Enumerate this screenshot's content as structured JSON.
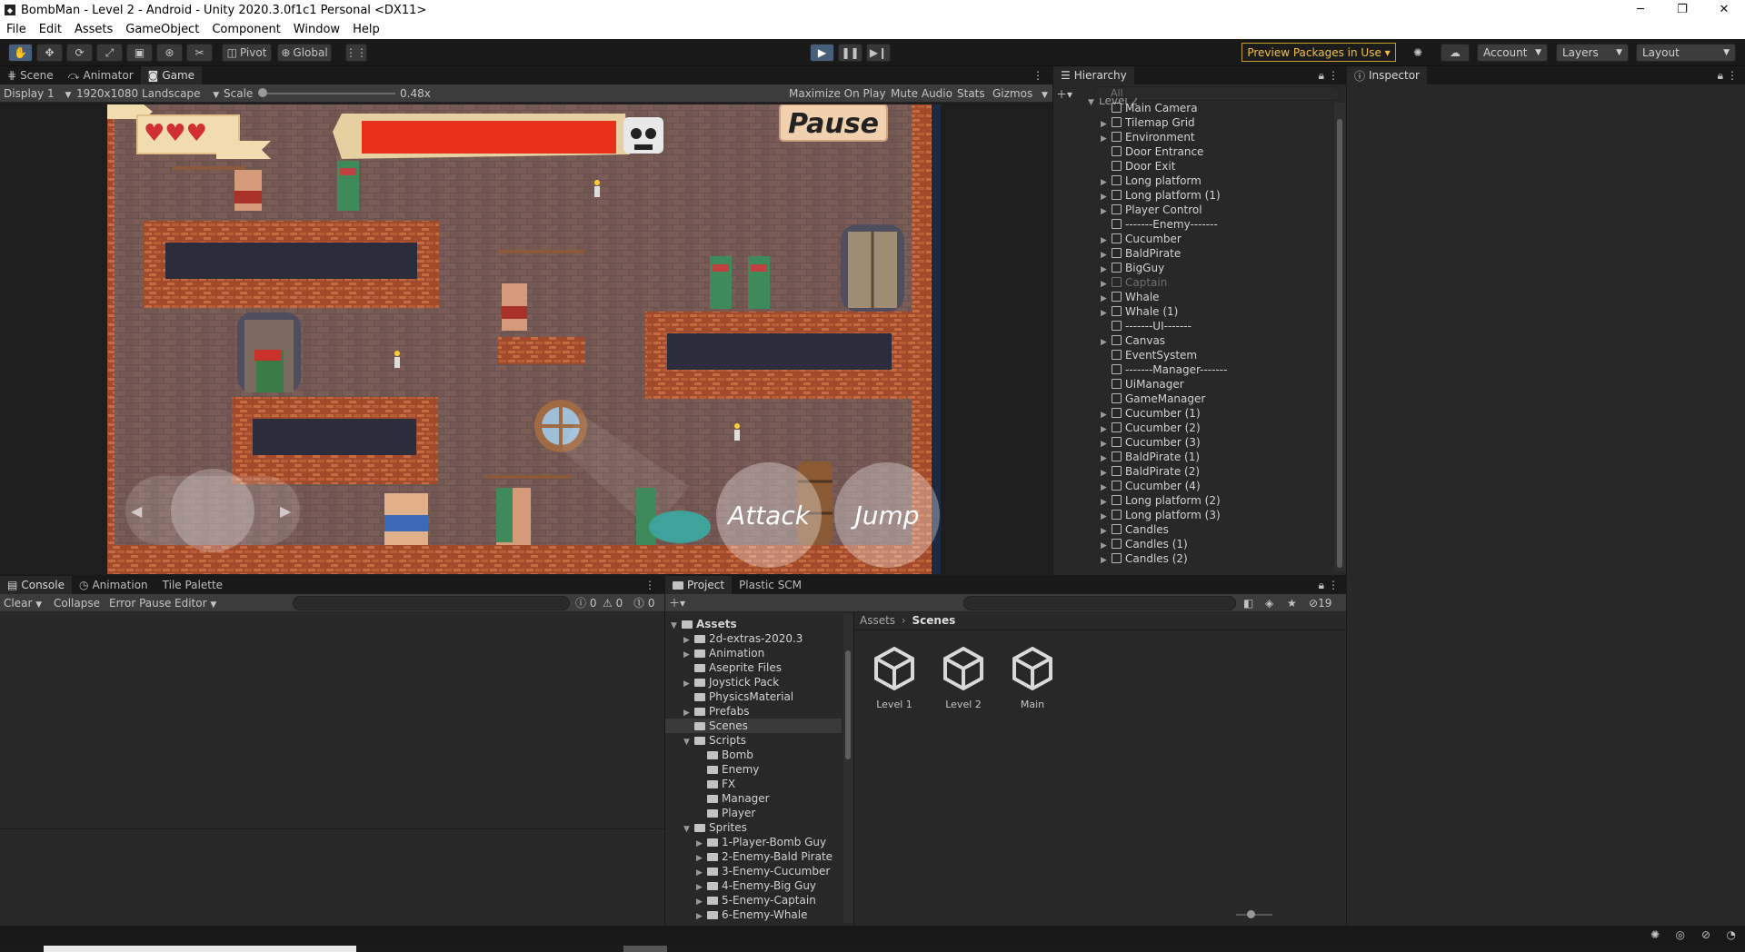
{
  "window": {
    "title": "BombMan - Level 2 - Android - Unity 2020.3.0f1c1 Personal <DX11>",
    "minimize": "─",
    "restore": "❐",
    "close": "✕"
  },
  "menu": [
    "File",
    "Edit",
    "Assets",
    "GameObject",
    "Component",
    "Window",
    "Help"
  ],
  "toolbar": {
    "pivot_label": "Pivot",
    "global_label": "Global",
    "preview_packages": "Preview Packages in Use ▾",
    "account": "Account",
    "layers": "Layers",
    "layout": "Layout"
  },
  "scene_tabs": [
    "Scene",
    "Animator",
    "Game"
  ],
  "game_bar": {
    "display": "Display 1",
    "resolution": "1920x1080 Landscape",
    "scale_label": "Scale",
    "scale_value": "0.48x",
    "maximize": "Maximize On Play",
    "mute": "Mute Audio",
    "stats": "Stats",
    "gizmos": "Gizmos"
  },
  "game_ui": {
    "pause": "Pause",
    "attack": "Attack",
    "jump": "Jump"
  },
  "hierarchy": {
    "tab": "Hierarchy",
    "search_placeholder": "All",
    "root": "Level 2",
    "items": [
      {
        "label": "Main Camera",
        "expandable": false,
        "dim": false
      },
      {
        "label": "Tilemap Grid",
        "expandable": true,
        "dim": false
      },
      {
        "label": "Environment",
        "expandable": true,
        "dim": false
      },
      {
        "label": "Door Entrance",
        "expandable": false,
        "dim": false
      },
      {
        "label": "Door Exit",
        "expandable": false,
        "dim": false
      },
      {
        "label": "Long platform",
        "expandable": true,
        "dim": false
      },
      {
        "label": "Long platform (1)",
        "expandable": true,
        "dim": false
      },
      {
        "label": "Player Control",
        "expandable": true,
        "dim": false
      },
      {
        "label": "-------Enemy-------",
        "expandable": false,
        "dim": false
      },
      {
        "label": "Cucumber",
        "expandable": true,
        "dim": false
      },
      {
        "label": "BaldPirate",
        "expandable": true,
        "dim": false
      },
      {
        "label": "BigGuy",
        "expandable": true,
        "dim": false
      },
      {
        "label": "Captain",
        "expandable": true,
        "dim": true
      },
      {
        "label": "Whale",
        "expandable": true,
        "dim": false
      },
      {
        "label": "Whale (1)",
        "expandable": true,
        "dim": false
      },
      {
        "label": "-------UI-------",
        "expandable": false,
        "dim": false
      },
      {
        "label": "Canvas",
        "expandable": true,
        "dim": false
      },
      {
        "label": "EventSystem",
        "expandable": false,
        "dim": false
      },
      {
        "label": "-------Manager-------",
        "expandable": false,
        "dim": false
      },
      {
        "label": "UiManager",
        "expandable": false,
        "dim": false
      },
      {
        "label": "GameManager",
        "expandable": false,
        "dim": false
      },
      {
        "label": "Cucumber (1)",
        "expandable": true,
        "dim": false
      },
      {
        "label": "Cucumber (2)",
        "expandable": true,
        "dim": false
      },
      {
        "label": "Cucumber (3)",
        "expandable": true,
        "dim": false
      },
      {
        "label": "BaldPirate (1)",
        "expandable": true,
        "dim": false
      },
      {
        "label": "BaldPirate (2)",
        "expandable": true,
        "dim": false
      },
      {
        "label": "Cucumber (4)",
        "expandable": true,
        "dim": false
      },
      {
        "label": "Long platform (2)",
        "expandable": true,
        "dim": false
      },
      {
        "label": "Long platform (3)",
        "expandable": true,
        "dim": false
      },
      {
        "label": "Candles",
        "expandable": true,
        "dim": false
      },
      {
        "label": "Candles (1)",
        "expandable": true,
        "dim": false
      },
      {
        "label": "Candles (2)",
        "expandable": true,
        "dim": false
      }
    ]
  },
  "inspector": {
    "tab": "Inspector"
  },
  "console": {
    "tabs": [
      "Console",
      "Animation",
      "Tile Palette"
    ],
    "clear": "Clear",
    "collapse": "Collapse",
    "error_pause": "Error Pause",
    "editor": "Editor",
    "count_info": "0",
    "count_warn": "0",
    "count_error": "0"
  },
  "project": {
    "tabs": [
      "Project",
      "Plastic SCM"
    ],
    "hidden_count": "19",
    "breadcrumb_root": "Assets",
    "breadcrumb_current": "Scenes",
    "tree": [
      {
        "label": "Assets",
        "depth": 0,
        "expanded": true,
        "selected": false
      },
      {
        "label": "2d-extras-2020.3",
        "depth": 1,
        "expanded": false,
        "selected": false
      },
      {
        "label": "Animation",
        "depth": 1,
        "expanded": false,
        "selected": false
      },
      {
        "label": "Aseprite Files",
        "depth": 1,
        "expanded": null,
        "selected": false
      },
      {
        "label": "Joystick Pack",
        "depth": 1,
        "expanded": false,
        "selected": false
      },
      {
        "label": "PhysicsMaterial",
        "depth": 1,
        "expanded": null,
        "selected": false
      },
      {
        "label": "Prefabs",
        "depth": 1,
        "expanded": false,
        "selected": false
      },
      {
        "label": "Scenes",
        "depth": 1,
        "expanded": null,
        "selected": true
      },
      {
        "label": "Scripts",
        "depth": 1,
        "expanded": true,
        "selected": false
      },
      {
        "label": "Bomb",
        "depth": 2,
        "expanded": null,
        "selected": false
      },
      {
        "label": "Enemy",
        "depth": 2,
        "expanded": null,
        "selected": false
      },
      {
        "label": "FX",
        "depth": 2,
        "expanded": null,
        "selected": false
      },
      {
        "label": "Manager",
        "depth": 2,
        "expanded": null,
        "selected": false
      },
      {
        "label": "Player",
        "depth": 2,
        "expanded": null,
        "selected": false
      },
      {
        "label": "Sprites",
        "depth": 1,
        "expanded": true,
        "selected": false
      },
      {
        "label": "1-Player-Bomb Guy",
        "depth": 2,
        "expanded": false,
        "selected": false
      },
      {
        "label": "2-Enemy-Bald Pirate",
        "depth": 2,
        "expanded": false,
        "selected": false
      },
      {
        "label": "3-Enemy-Cucumber",
        "depth": 2,
        "expanded": false,
        "selected": false
      },
      {
        "label": "4-Enemy-Big Guy",
        "depth": 2,
        "expanded": false,
        "selected": false
      },
      {
        "label": "5-Enemy-Captain",
        "depth": 2,
        "expanded": false,
        "selected": false
      },
      {
        "label": "6-Enemy-Whale",
        "depth": 2,
        "expanded": false,
        "selected": false
      }
    ],
    "scenes": [
      "Level 1",
      "Level 2",
      "Main"
    ]
  },
  "colors": {
    "accent": "#46607c",
    "preview_border": "#c99a2e",
    "health_bar": "#e8301a",
    "brick": "#6e5450"
  },
  "health_fraction": 1.0
}
